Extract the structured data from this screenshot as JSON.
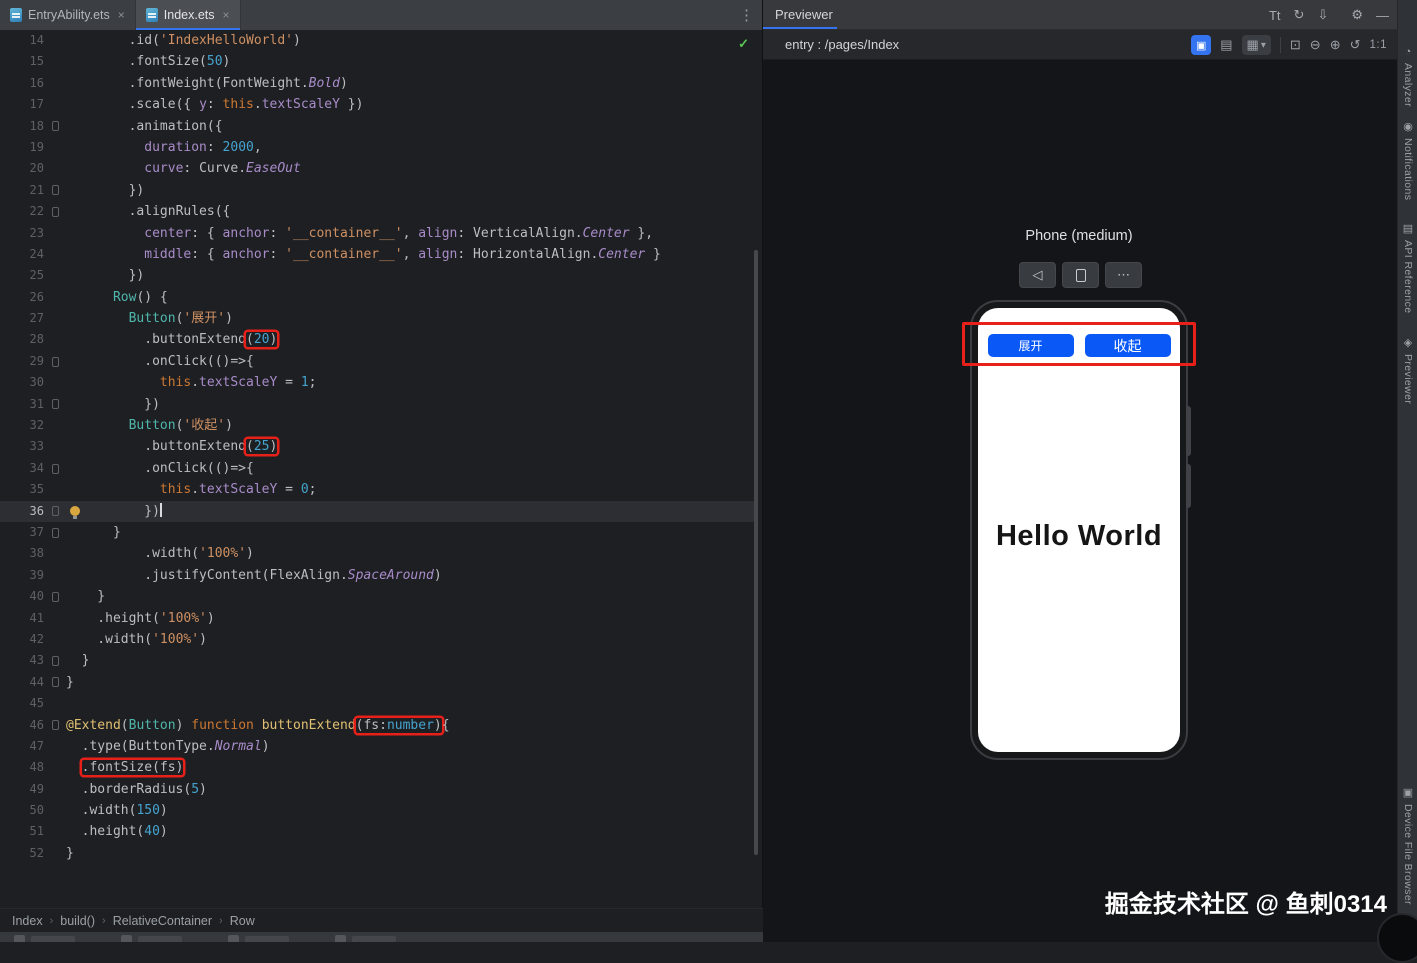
{
  "tabs": {
    "items": [
      {
        "label": "EntryAbility.ets"
      },
      {
        "label": "Index.ets"
      }
    ],
    "close_glyph": "×",
    "more_glyph": "⋮"
  },
  "editor": {
    "status_check": "✓",
    "crumb_sep": "›",
    "breadcrumb": [
      "Index",
      "build()",
      "RelativeContainer",
      "Row"
    ],
    "lines": [
      {
        "n": 14,
        "i": 8,
        "tk": [
          [
            "pl",
            ".id("
          ],
          [
            "str",
            "'IndexHelloWorld'"
          ],
          [
            "pl",
            ")"
          ]
        ]
      },
      {
        "n": 15,
        "i": 8,
        "tk": [
          [
            "pl",
            ".fontSize("
          ],
          [
            "num",
            "50"
          ],
          [
            "pl",
            ")"
          ]
        ]
      },
      {
        "n": 16,
        "i": 8,
        "tk": [
          [
            "pl",
            ".fontWeight("
          ],
          [
            "cls",
            "FontWeight"
          ],
          [
            "pl",
            "."
          ],
          [
            "en",
            "Bold"
          ],
          [
            "pl",
            ")"
          ]
        ]
      },
      {
        "n": 17,
        "i": 8,
        "tk": [
          [
            "pl",
            ".scale({ "
          ],
          [
            "prop",
            "y"
          ],
          [
            "pl",
            ": "
          ],
          [
            "kw",
            "this"
          ],
          [
            "pl",
            "."
          ],
          [
            "prop",
            "textScaleY"
          ],
          [
            "pl",
            " })"
          ]
        ]
      },
      {
        "n": 18,
        "i": 8,
        "f": 1,
        "tk": [
          [
            "pl",
            ".animation({"
          ]
        ]
      },
      {
        "n": 19,
        "i": 10,
        "tk": [
          [
            "prop",
            "duration"
          ],
          [
            "pl",
            ": "
          ],
          [
            "num",
            "2000"
          ],
          [
            "pl",
            ","
          ]
        ]
      },
      {
        "n": 20,
        "i": 10,
        "tk": [
          [
            "prop",
            "curve"
          ],
          [
            "pl",
            ": "
          ],
          [
            "cls",
            "Curve"
          ],
          [
            "pl",
            "."
          ],
          [
            "en",
            "EaseOut"
          ]
        ]
      },
      {
        "n": 21,
        "i": 8,
        "f": 1,
        "tk": [
          [
            "pl",
            "})"
          ]
        ]
      },
      {
        "n": 22,
        "i": 8,
        "f": 1,
        "tk": [
          [
            "pl",
            ".alignRules({"
          ]
        ]
      },
      {
        "n": 23,
        "i": 10,
        "tk": [
          [
            "prop",
            "center"
          ],
          [
            "pl",
            ": { "
          ],
          [
            "prop",
            "anchor"
          ],
          [
            "pl",
            ": "
          ],
          [
            "str",
            "'__container__'"
          ],
          [
            "pl",
            ", "
          ],
          [
            "prop",
            "align"
          ],
          [
            "pl",
            ": "
          ],
          [
            "cls",
            "VerticalAlign"
          ],
          [
            "pl",
            "."
          ],
          [
            "en",
            "Center"
          ],
          [
            "pl",
            " },"
          ]
        ]
      },
      {
        "n": 24,
        "i": 10,
        "tk": [
          [
            "prop",
            "middle"
          ],
          [
            "pl",
            ": { "
          ],
          [
            "prop",
            "anchor"
          ],
          [
            "pl",
            ": "
          ],
          [
            "str",
            "'__container__'"
          ],
          [
            "pl",
            ", "
          ],
          [
            "prop",
            "align"
          ],
          [
            "pl",
            ": "
          ],
          [
            "cls",
            "HorizontalAlign"
          ],
          [
            "pl",
            "."
          ],
          [
            "en",
            "Center"
          ],
          [
            "pl",
            " }"
          ]
        ]
      },
      {
        "n": 25,
        "i": 8,
        "tk": [
          [
            "pl",
            "})"
          ]
        ]
      },
      {
        "n": 26,
        "i": 6,
        "tk": [
          [
            "comp",
            "Row"
          ],
          [
            "pl",
            "() {"
          ]
        ]
      },
      {
        "n": 27,
        "i": 8,
        "tk": [
          [
            "comp",
            "Button"
          ],
          [
            "pl",
            "("
          ],
          [
            "str",
            "'展开'"
          ],
          [
            "pl",
            ")"
          ]
        ]
      },
      {
        "n": 28,
        "i": 10,
        "tk": [
          [
            "pl",
            ".buttonExtend"
          ],
          [
            "box",
            [
              [
                "pl",
                "("
              ],
              [
                "num",
                "20"
              ],
              [
                "pl",
                ")"
              ]
            ]
          ]
        ]
      },
      {
        "n": 29,
        "i": 10,
        "f": 1,
        "tk": [
          [
            "pl",
            ".onClick(()=>{"
          ]
        ]
      },
      {
        "n": 30,
        "i": 12,
        "tk": [
          [
            "kw",
            "this"
          ],
          [
            "pl",
            "."
          ],
          [
            "prop",
            "textScaleY"
          ],
          [
            "pl",
            " = "
          ],
          [
            "num",
            "1"
          ],
          [
            "pl",
            ";"
          ]
        ]
      },
      {
        "n": 31,
        "i": 10,
        "f": 1,
        "tk": [
          [
            "pl",
            "})"
          ]
        ]
      },
      {
        "n": 32,
        "i": 8,
        "tk": [
          [
            "comp",
            "Button"
          ],
          [
            "pl",
            "("
          ],
          [
            "str",
            "'收起'"
          ],
          [
            "pl",
            ")"
          ]
        ]
      },
      {
        "n": 33,
        "i": 10,
        "tk": [
          [
            "pl",
            ".buttonExtend"
          ],
          [
            "box",
            [
              [
                "pl",
                "("
              ],
              [
                "num",
                "25"
              ],
              [
                "pl",
                ")"
              ]
            ]
          ]
        ]
      },
      {
        "n": 34,
        "i": 10,
        "f": 1,
        "tk": [
          [
            "pl",
            ".onClick(()=>{"
          ]
        ]
      },
      {
        "n": 35,
        "i": 12,
        "tk": [
          [
            "kw",
            "this"
          ],
          [
            "pl",
            "."
          ],
          [
            "prop",
            "textScaleY"
          ],
          [
            "pl",
            " = "
          ],
          [
            "num",
            "0"
          ],
          [
            "pl",
            ";"
          ]
        ]
      },
      {
        "n": 36,
        "i": 10,
        "f": 1,
        "cur": 1,
        "caret": 1,
        "bulb": 1,
        "tk": [
          [
            "pl",
            "})"
          ]
        ]
      },
      {
        "n": 37,
        "i": 6,
        "f": 1,
        "tk": [
          [
            "pl",
            "}"
          ]
        ]
      },
      {
        "n": 38,
        "i": 10,
        "tk": [
          [
            "pl",
            ".width("
          ],
          [
            "str",
            "'100%'"
          ],
          [
            "pl",
            ")"
          ]
        ]
      },
      {
        "n": 39,
        "i": 10,
        "tk": [
          [
            "pl",
            ".justifyContent("
          ],
          [
            "cls",
            "FlexAlign"
          ],
          [
            "pl",
            "."
          ],
          [
            "en",
            "SpaceAround"
          ],
          [
            "pl",
            ")"
          ]
        ]
      },
      {
        "n": 40,
        "i": 4,
        "f": 1,
        "tk": [
          [
            "pl",
            "}"
          ]
        ]
      },
      {
        "n": 41,
        "i": 4,
        "tk": [
          [
            "pl",
            ".height("
          ],
          [
            "str",
            "'100%'"
          ],
          [
            "pl",
            ")"
          ]
        ]
      },
      {
        "n": 42,
        "i": 4,
        "tk": [
          [
            "pl",
            ".width("
          ],
          [
            "str",
            "'100%'"
          ],
          [
            "pl",
            ")"
          ]
        ]
      },
      {
        "n": 43,
        "i": 2,
        "f": 1,
        "tk": [
          [
            "pl",
            "}"
          ]
        ]
      },
      {
        "n": 44,
        "i": 0,
        "f": 1,
        "tk": [
          [
            "pl",
            "}"
          ]
        ]
      },
      {
        "n": 45,
        "i": 0,
        "tk": []
      },
      {
        "n": 46,
        "i": 0,
        "f": 1,
        "tk": [
          [
            "deco",
            "@Extend"
          ],
          [
            "pl",
            "("
          ],
          [
            "comp",
            "Button"
          ],
          [
            "pl",
            ") "
          ],
          [
            "kw",
            "function"
          ],
          [
            "pl",
            " "
          ],
          [
            "fn",
            "buttonExtend"
          ],
          [
            "box",
            [
              [
                "pl",
                "("
              ],
              [
                "pl",
                "fs"
              ],
              [
                "pl",
                ":"
              ],
              [
                "type",
                "number"
              ],
              [
                "pl",
                ")"
              ]
            ]
          ],
          [
            "pl",
            "{"
          ]
        ]
      },
      {
        "n": 47,
        "i": 2,
        "tk": [
          [
            "pl",
            ".type("
          ],
          [
            "cls",
            "ButtonType"
          ],
          [
            "pl",
            "."
          ],
          [
            "en",
            "Normal"
          ],
          [
            "pl",
            ")"
          ]
        ]
      },
      {
        "n": 48,
        "i": 2,
        "tk": [
          [
            "box",
            [
              [
                "pl",
                ".fontSize("
              ],
              [
                "pl",
                "fs"
              ],
              [
                "pl",
                ")"
              ]
            ]
          ]
        ]
      },
      {
        "n": 49,
        "i": 2,
        "tk": [
          [
            "pl",
            ".borderRadius("
          ],
          [
            "num",
            "5"
          ],
          [
            "pl",
            ")"
          ]
        ]
      },
      {
        "n": 50,
        "i": 2,
        "tk": [
          [
            "pl",
            ".width("
          ],
          [
            "num",
            "150"
          ],
          [
            "pl",
            ")"
          ]
        ]
      },
      {
        "n": 51,
        "i": 2,
        "tk": [
          [
            "pl",
            ".height("
          ],
          [
            "num",
            "40"
          ],
          [
            "pl",
            ")"
          ]
        ]
      },
      {
        "n": 52,
        "i": 0,
        "tk": [
          [
            "pl",
            "}"
          ]
        ]
      }
    ]
  },
  "previewer": {
    "title": "Previewer",
    "header_icons": [
      {
        "name": "font-size",
        "glyph": "Tt"
      },
      {
        "name": "refresh",
        "glyph": "↻"
      },
      {
        "name": "dock",
        "glyph": "⇩"
      },
      {
        "name": "settings",
        "glyph": "⚙"
      },
      {
        "name": "minimize",
        "glyph": "—"
      }
    ],
    "entry_label": "entry : /pages/Index",
    "entry_icons": [
      {
        "name": "inspect",
        "glyph": "▣"
      },
      {
        "name": "layers",
        "glyph": "▤"
      },
      {
        "name": "grid",
        "glyph": "▦"
      },
      {
        "name": "chevron-down",
        "glyph": "▾"
      },
      {
        "name": "frame-select",
        "glyph": "⊡"
      },
      {
        "name": "zoom-out",
        "glyph": "⊖"
      },
      {
        "name": "zoom-in",
        "glyph": "⊕"
      },
      {
        "name": "zoom-reset",
        "glyph": "↺"
      },
      {
        "name": "zoom-ratio",
        "glyph": "1:1"
      }
    ],
    "device_name": "Phone (medium)",
    "device_buttons": [
      {
        "name": "previous",
        "glyph": "◁"
      },
      {
        "name": "rotate",
        "glyph": ""
      },
      {
        "name": "more",
        "glyph": "⋯"
      }
    ],
    "screen": {
      "buttons": [
        "展开",
        "收起"
      ],
      "hello": "Hello World"
    }
  },
  "right_strip": {
    "items": [
      {
        "label": "Analyzer",
        "icon": "◔"
      },
      {
        "label": "Notifications",
        "icon": "◉"
      },
      {
        "label": "API Reference",
        "icon": "▤"
      },
      {
        "label": "Previewer",
        "icon": "◈"
      },
      {
        "label": "Device File Browser",
        "icon": "▣"
      }
    ]
  },
  "watermark": "掘金技术社区 @ 鱼刺0314",
  "colors": {
    "accent_blue": "#3574f0",
    "harmony_button_blue": "#0a59f7",
    "annotation_red": "#e8201a",
    "success_green": "#57c554"
  }
}
